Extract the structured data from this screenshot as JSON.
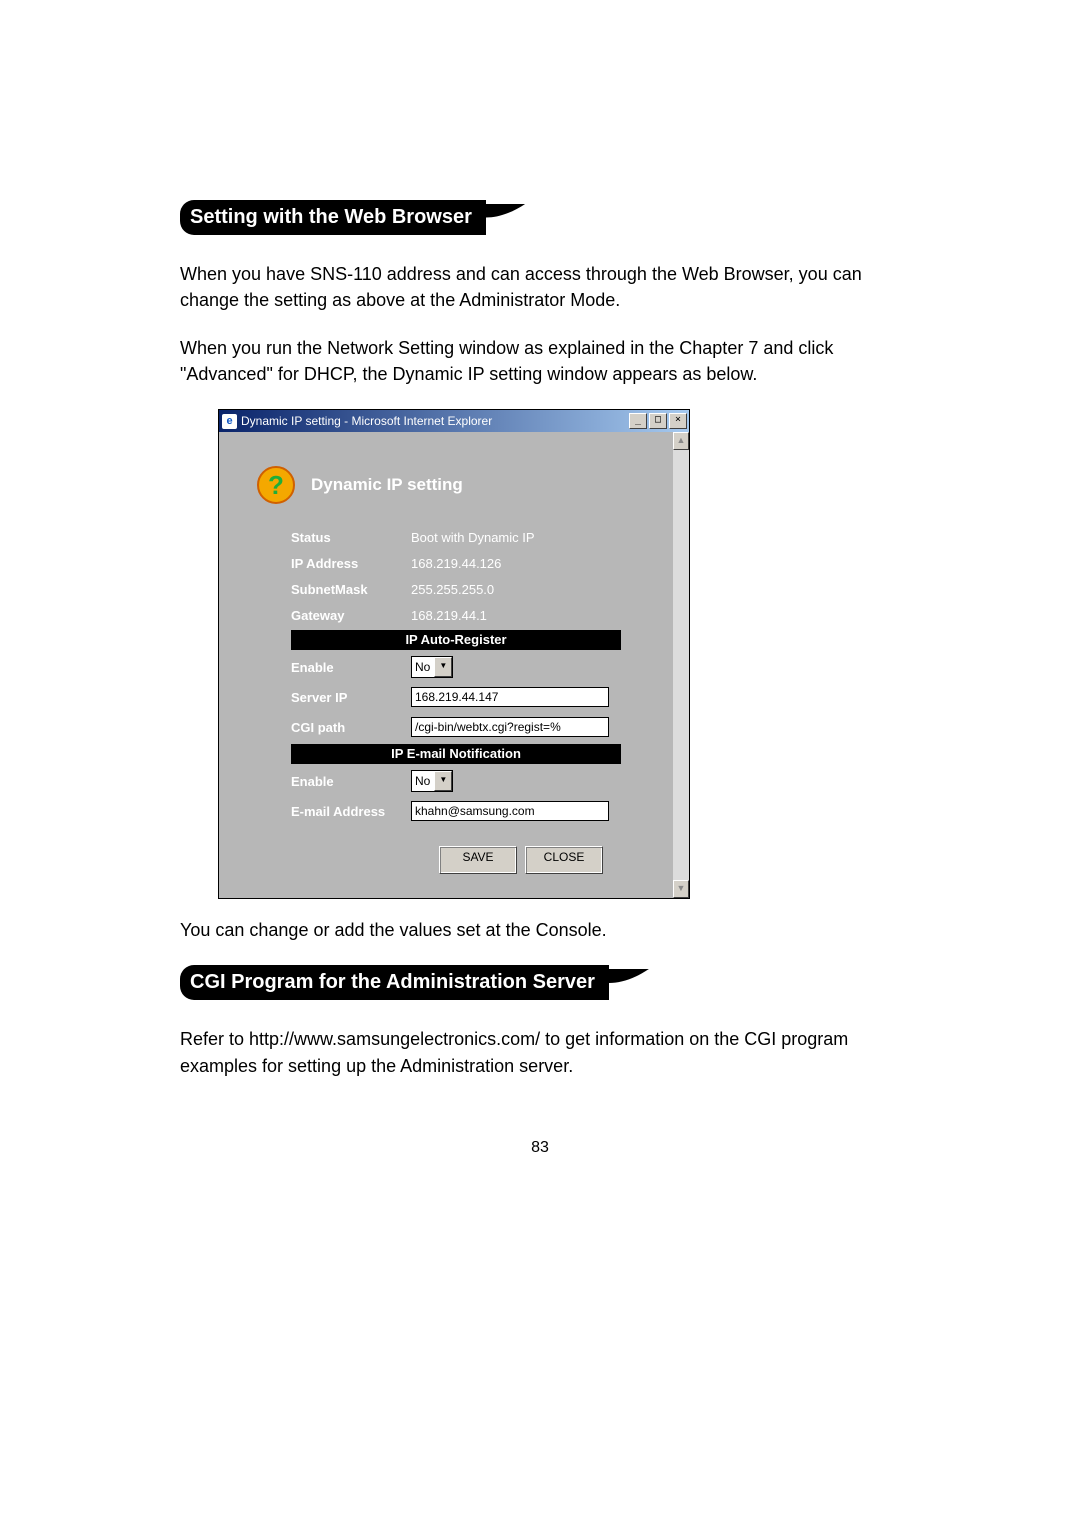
{
  "page_number": "83",
  "section1": {
    "title": "Setting with the Web Browser",
    "para1": "When you have SNS-110 address and can access through the Web Browser, you can change the setting as above at the Administrator Mode.",
    "para2": "When you run the Network Setting window as explained in the Chapter 7 and click \"Advanced\" for DHCP, the Dynamic IP setting window appears as below."
  },
  "window": {
    "title": "Dynamic IP setting - Microsoft Internet Explorer",
    "heading": "Dynamic IP setting",
    "rows": {
      "status_label": "Status",
      "status_value": "Boot with Dynamic IP",
      "ip_label": "IP Address",
      "ip_value": "168.219.44.126",
      "mask_label": "SubnetMask",
      "mask_value": "255.255.255.0",
      "gw_label": "Gateway",
      "gw_value": "168.219.44.1"
    },
    "auto_register": {
      "header": "IP Auto-Register",
      "enable_label": "Enable",
      "enable_value": "No",
      "server_label": "Server IP",
      "server_value": "168.219.44.147",
      "cgi_label": "CGI path",
      "cgi_value": "/cgi-bin/webtx.cgi?regist=%"
    },
    "email_notify": {
      "header": "IP E-mail Notification",
      "enable_label": "Enable",
      "enable_value": "No",
      "email_label": "E-mail Address",
      "email_value": "khahn@samsung.com"
    },
    "buttons": {
      "save": "SAVE",
      "close": "CLOSE"
    }
  },
  "after_window": "You can change or add the values set at the Console.",
  "section2": {
    "title": "CGI Program for the Administration Server",
    "para": "Refer to http://www.samsungelectronics.com/ to get information on the CGI program examples for setting up the Administration server."
  }
}
